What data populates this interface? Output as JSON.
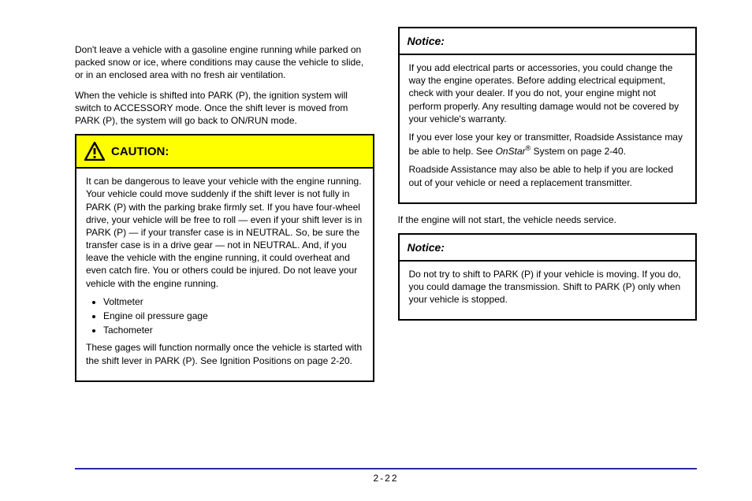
{
  "left": {
    "p1": "Don't leave a vehicle with a gasoline engine running while parked on packed snow or ice, where conditions may cause the vehicle to slide, or in an enclosed area with no fresh air ventilation.",
    "p2": "When the vehicle is shifted into PARK (P), the ignition system will switch to ACCESSORY mode. Once the shift lever is moved from PARK (P), the system will go back to ON/RUN mode."
  },
  "caution": {
    "icon_name": "warning-triangle-icon",
    "title": "CAUTION:",
    "intro": "It can be dangerous to leave your vehicle with the engine running. Your vehicle could move suddenly if the shift lever is not fully in PARK (P) with the parking brake firmly set. If you have four-wheel drive, your vehicle will be free to roll — even if your shift lever is in PARK (P) — if your transfer case is in NEUTRAL. So, be sure the transfer case is in a drive gear — not in NEUTRAL. And, if you leave the vehicle with the engine running, it could overheat and even catch fire. You or others could be injured. Do not leave your vehicle with the engine running.",
    "bullets": [
      "Voltmeter",
      "Engine oil pressure gage",
      "Tachometer"
    ],
    "outro": "These gages will function normally once the vehicle is started with the shift lever in PARK (P). See Ignition Positions on page 2-20."
  },
  "notice1": {
    "title": "Notice:",
    "b1": "If you add electrical parts or accessories, you could change the way the engine operates. Before adding electrical equipment, check with your dealer. If you do not, your engine might not perform properly. Any resulting damage would not be covered by your vehicle's warranty.",
    "b2_a": "If you ever lose your key or transmitter, Roadside Assistance may be able to help. See ",
    "b2_em": "OnStar",
    "b2_reg": "®",
    "b2_b": " System on page 2-40.",
    "b3": "Roadside Assistance may also be able to help if you are locked out of your vehicle or need a replacement transmitter."
  },
  "between": "If the engine will not start, the vehicle needs service.",
  "notice2": {
    "title": "Notice:",
    "b1": "Do not try to shift to PARK (P) if your vehicle is moving. If you do, you could damage the transmission. Shift to PARK (P) only when your vehicle is stopped."
  },
  "page_number": "2-22"
}
